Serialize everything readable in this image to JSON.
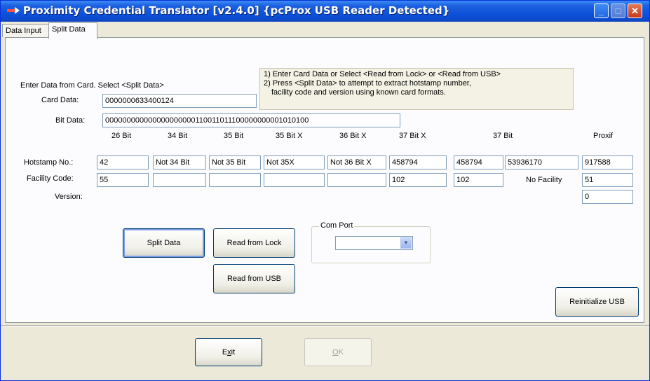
{
  "window": {
    "title": "Proximity Credential Translator [v2.4.0] {pcProx USB Reader Detected}",
    "minimize_glyph": "_",
    "maximize_glyph": "□",
    "close_glyph": "✕"
  },
  "tabs": [
    {
      "label": "Data Input"
    },
    {
      "label": "Split Data"
    }
  ],
  "form": {
    "instruction": "Enter Data from Card. Select <Split Data>",
    "card_data_label": "Card Data:",
    "card_data_value": "0000000633400124",
    "bit_data_label": "Bit Data:",
    "bit_data_value": "000000000000000000000110011011100000000001010100"
  },
  "note": {
    "line1": "1) Enter Card Data or Select <Read from Lock> or <Read from USB>",
    "line2": "2) Press <Split Data> to attempt to extract hotstamp number,",
    "line3": "facility code and version using known card formats."
  },
  "columns": [
    "26 Bit",
    "34 Bit",
    "35 Bit",
    "35 Bit X",
    "36 Bit X",
    "37 Bit X",
    "37 Bit",
    "Proxif"
  ],
  "row_labels": {
    "hotstamp": "Hotstamp No.:",
    "facility": "Facility Code:",
    "version": "Version:"
  },
  "hotstamp": [
    "42",
    "Not 34 Bit",
    "Not 35 Bit",
    "Not 35X",
    "Not 36 Bit X",
    "458794",
    "458794",
    "53936170",
    "917588"
  ],
  "facility": [
    "55",
    "",
    "",
    "",
    "",
    "102",
    "102",
    "51"
  ],
  "facility_note": "No Facility",
  "version": [
    "0"
  ],
  "buttons": {
    "split_data": "Split Data",
    "read_lock": "Read from Lock",
    "read_usb": "Read from USB",
    "reinit_usb": "Reinitialize USB",
    "exit_pre": "E",
    "exit_u": "x",
    "exit_post": "it",
    "ok_u": "O",
    "ok_post": "K"
  },
  "com_port": {
    "label": "Com Port",
    "value": ""
  }
}
